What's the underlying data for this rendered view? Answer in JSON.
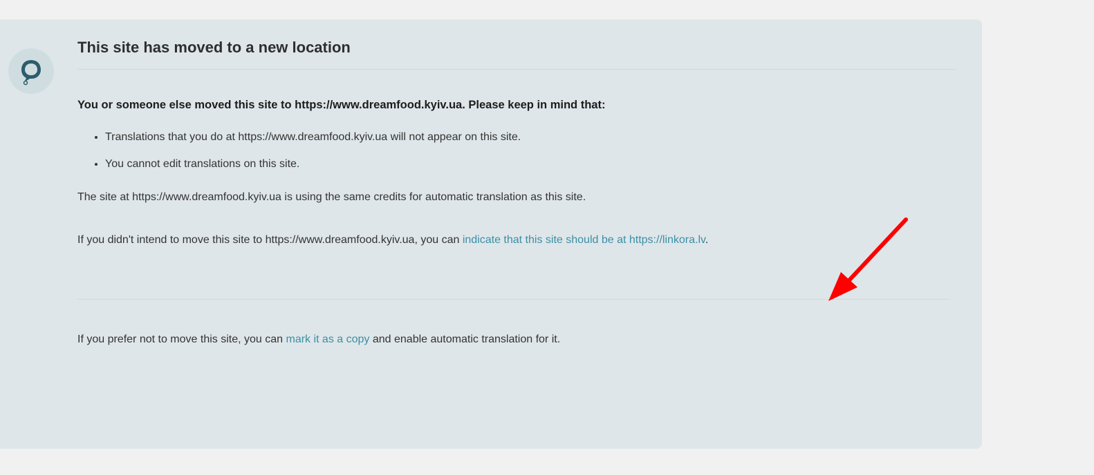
{
  "notice": {
    "title": "This site has moved to a new location",
    "lead": "You or someone else moved this site to https://www.dreamfood.kyiv.ua. Please keep in mind that:",
    "bullets": [
      "Translations that you do at https://www.dreamfood.kyiv.ua will not appear on this site.",
      "You cannot edit translations on this site."
    ],
    "credits_text": "The site at https://www.dreamfood.kyiv.ua is using the same credits for automatic translation as this site.",
    "intend_prefix": "If you didn't intend to move this site to https://www.dreamfood.kyiv.ua, you can ",
    "intend_link": "indicate that this site should be at https://linkora.lv",
    "intend_suffix": ".",
    "copy_prefix": "If you prefer not to move this site, you can ",
    "copy_link": "mark it as a copy",
    "copy_suffix": " and enable automatic translation for it."
  },
  "colors": {
    "panel_bg": "#dfe6e9",
    "link": "#3a8fa5",
    "arrow": "#ff0000",
    "logo_bg": "#cfdde1",
    "logo_fg": "#2c5d6b"
  },
  "icons": {
    "logo": "speech-bubble-logo-icon",
    "annotation": "red-arrow-icon"
  }
}
